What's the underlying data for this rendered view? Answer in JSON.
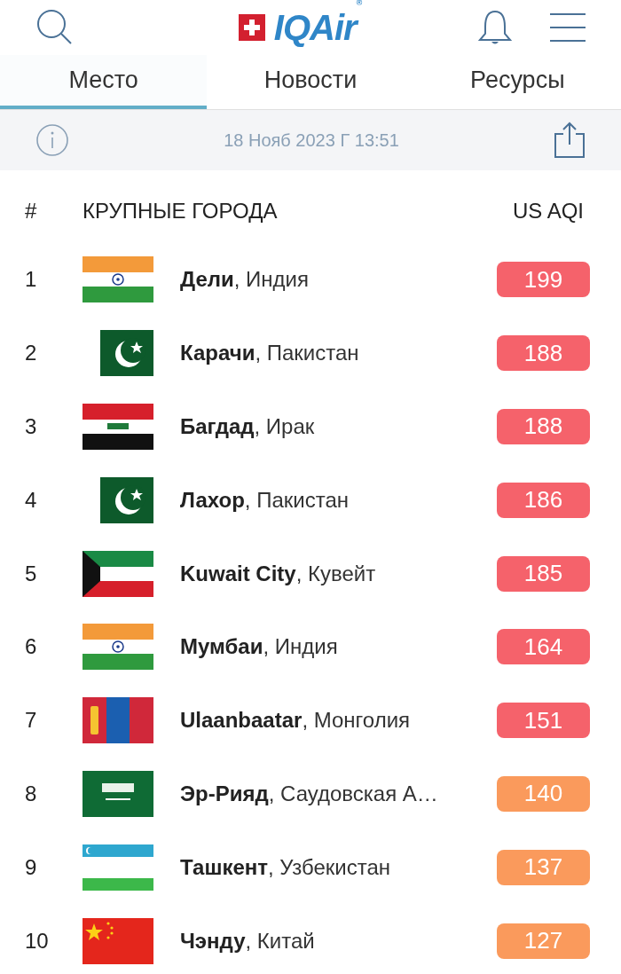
{
  "header": {
    "logo": "IQAir$^{®}$"
  },
  "tabs": [
    {
      "label": "Место",
      "selected": true
    },
    {
      "label": "Новости",
      "selected": false
    },
    {
      "label": "Ресурсы",
      "selected": false
    }
  ],
  "date_bar": {
    "date": "18 Нояб 2023 Г 13:51"
  },
  "table": {
    "columns": [
      "#",
      "КРУПНЫЕ ГОРОДА",
      "US AQI"
    ],
    "rows": [
      {
        "rank": "1",
        "kind": "india",
        "name": "**Дели**, Индия",
        "aqi": "199",
        "color": "#f5626b"
      },
      {
        "rank": "2",
        "kind": "pakistan",
        "name": "**Карачи**, Пакистан",
        "aqi": "188",
        "color": "#f5626b"
      },
      {
        "rank": "3",
        "kind": "iraq",
        "name": "**Багдад**, Ирак",
        "aqi": "188",
        "color": "#f5626b"
      },
      {
        "rank": "4",
        "kind": "pakistan",
        "name": "**Лахор**, Пакистан",
        "aqi": "186",
        "color": "#f5626b"
      },
      {
        "rank": "5",
        "kind": "kuwait",
        "name": "**Kuwait City**, Кувейт",
        "aqi": "185",
        "color": "#f5626b"
      },
      {
        "rank": "6",
        "kind": "india",
        "name": "**Мумбаи**, Индия",
        "aqi": "164",
        "color": "#f5626b"
      },
      {
        "rank": "7",
        "kind": "mongolia",
        "name": "**Ulaanbaatar**, Монголия",
        "aqi": "151",
        "color": "#f5626b"
      },
      {
        "rank": "8",
        "kind": "saudi",
        "name": "**Эр-Рияд**, Саудовская А…",
        "aqi": "140",
        "color": "#fa9a5c"
      },
      {
        "rank": "9",
        "kind": "uzbekistan",
        "name": "**Ташкент**, Узбекистан",
        "aqi": "137",
        "color": "#fa9a5c"
      },
      {
        "rank": "10",
        "kind": "china",
        "name": "**Чэнду**, Китай",
        "aqi": "127",
        "color": "#fa9a5c"
      }
    ]
  }
}
